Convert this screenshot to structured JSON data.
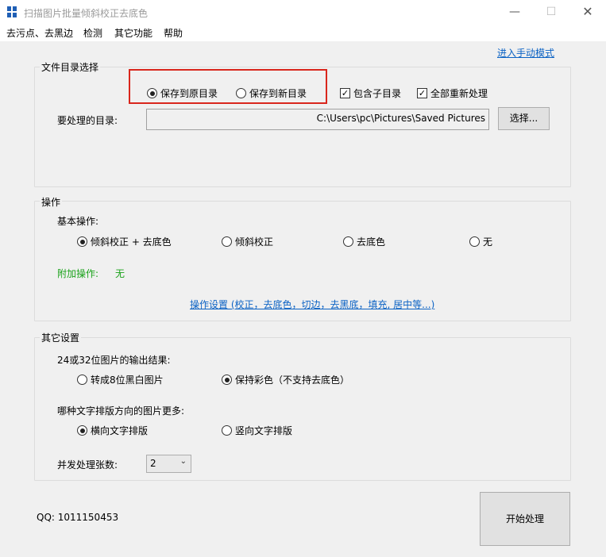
{
  "window": {
    "title": "扫描图片批量倾斜校正去底色",
    "minimize_icon": "minimize-icon",
    "maximize_icon": "maximize-icon",
    "close_icon": "close-icon"
  },
  "menu": {
    "items": [
      "去污点、去黑边",
      "检测",
      "其它功能",
      "帮助"
    ]
  },
  "manual_mode_link": "进入手动模式",
  "file_section": {
    "title": "文件目录选择",
    "save_original": "保存到原目录",
    "save_new": "保存到新目录",
    "include_subdirs": "包含子目录",
    "reprocess_all": "全部重新处理",
    "dir_label": "要处理的目录:",
    "dir_value": "C:\\Users\\pc\\Pictures\\Saved Pictures",
    "choose_button": "选择..."
  },
  "operation_section": {
    "title": "操作",
    "basic_label": "基本操作:",
    "options": [
      "倾斜校正 + 去底色",
      "倾斜校正",
      "去底色",
      "无"
    ],
    "selected_option": "倾斜校正 + 去底色",
    "extra_label": "附加操作:",
    "extra_value": "无",
    "settings_link": "操作设置 (校正，去底色，切边，去黑底，填充, 居中等...)"
  },
  "other_section": {
    "title": "其它设置",
    "output_label": "24或32位图片的输出结果:",
    "output_options": [
      "转成8位黑白图片",
      "保持彩色（不支持去底色）"
    ],
    "output_selected": "保持彩色（不支持去底色）",
    "direction_label": "哪种文字排版方向的图片更多:",
    "direction_options": [
      "横向文字排版",
      "竖向文字排版"
    ],
    "direction_selected": "横向文字排版",
    "concurrency_label": "并发处理张数:",
    "concurrency_value": "2"
  },
  "footer": {
    "qq": "QQ: 1011150453",
    "start_button": "开始处理"
  },
  "colors": {
    "highlight": "#d9261c",
    "link": "#0b62c4",
    "green": "#1aa21a",
    "brand_icon": "#1f5fb5"
  }
}
